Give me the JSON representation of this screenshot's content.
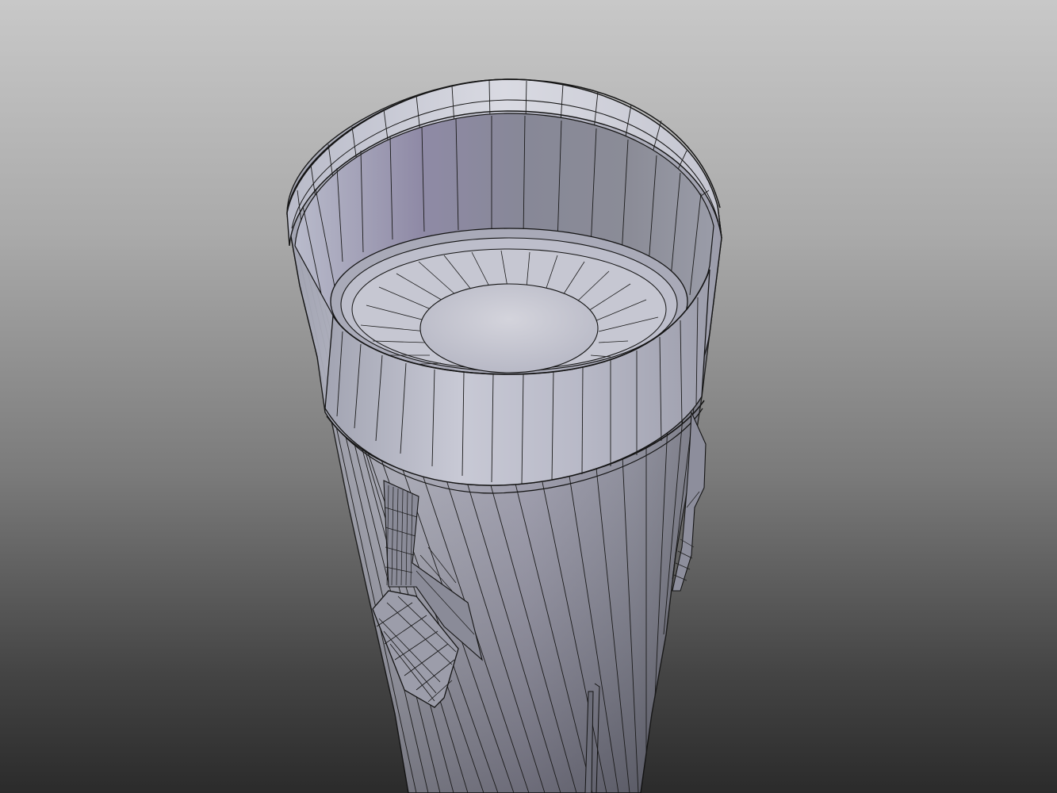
{
  "scene": {
    "background_top": "#c8c8c8",
    "background_bottom": "#2b2b2b",
    "wire_color": "#141414",
    "surface_light": "#c9cad6",
    "surface_mid": "#9b9dae",
    "surface_dark": "#6f7080",
    "subject": "wireframe-tube-model"
  }
}
